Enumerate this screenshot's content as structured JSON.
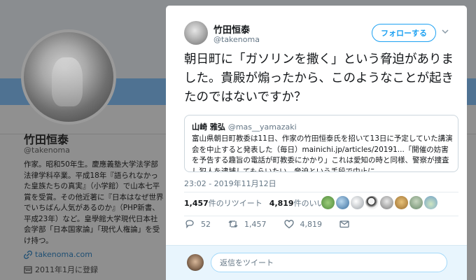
{
  "profile": {
    "name": "竹田恒泰",
    "handle": "@takenoma",
    "bio": "作家。昭和50年生。慶應義塾大学法学部法律学科卒業。平成18年『語られなかった皇族たちの真実』（小学館）で山本七平賞を受賞。その他近著に『日本はなぜ世界でいちばん人気があるのか』（PHP新書、平成23年）など。皇學館大学現代日本社会学部「日本国家論」「現代人権論」を受け持つ。",
    "website": "takenoma.com",
    "joined": "2011年1月に登録"
  },
  "tweet": {
    "author_name": "竹田恒泰",
    "author_handle": "@takenoma",
    "follow_label": "フォローする",
    "text": "朝日町に「ガソリンを撒く」という脅迫がありました。貴殿が煽ったから、このようなことが起きたのではないですか？",
    "timestamp": "23:02 - 2019年11月12日"
  },
  "quote": {
    "name": "山崎 雅弘",
    "handle": "@mas__yamazaki",
    "text": "富山県朝日町教委は11日、作家の竹田恒泰氏を招いて13日に予定していた講演会を中止すると発表した（毎日）mainichi.jp/articles/20191...「開催の妨害を予告する趣旨の電話が町教委にかかり」これは愛知の時と同様、警察が捜査し犯人を逮捕してもらいたい。脅迫という手段で中止に"
  },
  "stats": {
    "retweets": "1,457",
    "retweets_label": "件のリツイート",
    "likes": "4,819",
    "likes_label": "件のいいね"
  },
  "actions": {
    "replies": "52",
    "retweets": "1,457",
    "likes": "4,819"
  },
  "reply": {
    "placeholder": "返信をツイート"
  },
  "colors": {
    "accent": "#1da1f2",
    "secondary_text": "#657786",
    "primary_text": "#14171a"
  }
}
